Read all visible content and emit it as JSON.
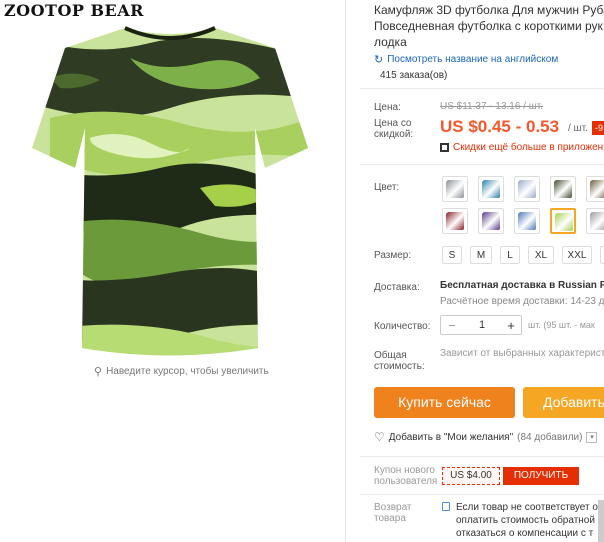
{
  "brand": "ZOOTOP BEAR",
  "zoom_hint": "Наведите курсор, чтобы увеличить",
  "title_lines": [
    "Камуфляж 3D футболка Для мужчин Руба",
    "Повседневная футболка с короткими рук",
    "лодка"
  ],
  "translate_link": "Посмотреть название на английском",
  "orders": "415 заказа(ов)",
  "labels": {
    "price": "Цена:",
    "discount_price": [
      "Цена со",
      "скидкой:"
    ],
    "color": "Цвет:",
    "size": "Размер:",
    "shipping": "Доставка:",
    "quantity": "Количество:",
    "total": [
      "Общая",
      "стоимость:"
    ],
    "coupon": [
      "Купон нового",
      "пользователя"
    ],
    "return": [
      "Возврат",
      "товара"
    ]
  },
  "price": {
    "old": "US $11.37 - 13.16 / шт.",
    "new": "US $0.45 - 0.53",
    "unit": "/ шт.",
    "badge": "-9",
    "app_promo": "Скидки ещё больше в приложен"
  },
  "colors": {
    "swatches": [
      "#8a8f96",
      "#2a7fa8",
      "#9aa7c8",
      "#3d4a2c",
      "#6b5a3a",
      "#8a1c2b",
      "#5a3a8a",
      "#4a78b8",
      "#a6d04a",
      "#9a9a9a"
    ],
    "selected_index": 8
  },
  "sizes": [
    "S",
    "M",
    "L",
    "XL",
    "XXL"
  ],
  "shipping": {
    "free": "Бесплатная доставка в Russian Fe",
    "eta": "Расчётное время доставки: 14-23 д"
  },
  "quantity": {
    "minus": "−",
    "value": "1",
    "plus": "+",
    "available": "шт. (95 шт. - мак"
  },
  "total_note": "Зависит от выбранных характерист",
  "buttons": {
    "buy": "Купить сейчас",
    "cart": "Добавить"
  },
  "wishlist": {
    "label": "Добавить в \"Мои желания\"",
    "count": "(84 добавили)"
  },
  "coupon": {
    "price": "US $4.00",
    "get": "ПОЛУЧИТЬ"
  },
  "return_lines": [
    "Если товар не соответствует опи",
    "оплатить стоимость обратной пе",
    "отказаться о компенсации с т"
  ]
}
